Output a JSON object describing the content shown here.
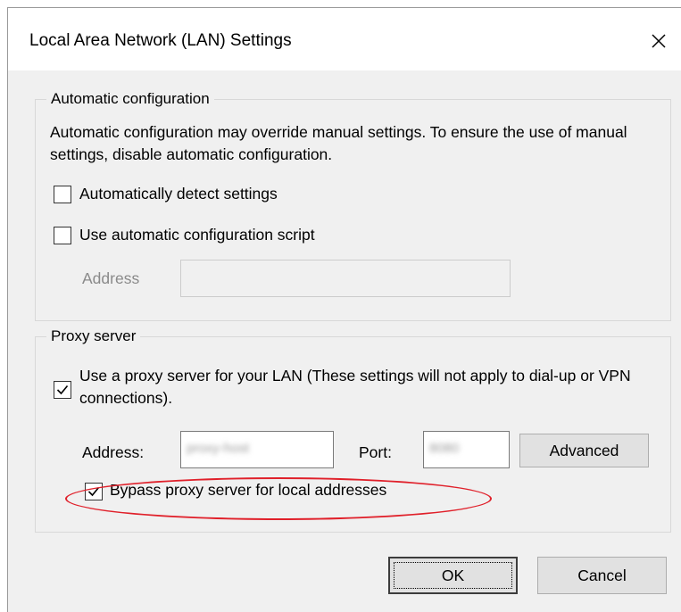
{
  "window": {
    "title": "Local Area Network (LAN) Settings",
    "close_glyph": "✕"
  },
  "auto_config": {
    "group_label": "Automatic configuration",
    "description": "Automatic configuration may override manual settings.  To ensure the use of manual settings, disable automatic configuration.",
    "detect_settings": {
      "label": "Automatically detect settings",
      "checked": false
    },
    "use_script": {
      "label": "Use automatic configuration script",
      "checked": false
    },
    "address_label": "Address",
    "address_value": ""
  },
  "proxy": {
    "group_label": "Proxy server",
    "use_proxy": {
      "label": "Use a proxy server for your LAN (These settings will not apply to dial-up or VPN connections).",
      "checked": true
    },
    "address_label": "Address:",
    "address_value": "proxy-host",
    "port_label": "Port:",
    "port_value": "8080",
    "advanced_label": "Advanced",
    "bypass_local": {
      "label": "Bypass proxy server for local addresses",
      "checked": true
    }
  },
  "buttons": {
    "ok_label": "OK",
    "cancel_label": "Cancel"
  },
  "colors": {
    "annotation": "#e0202a",
    "dialog_bg": "#f0f0f0"
  }
}
